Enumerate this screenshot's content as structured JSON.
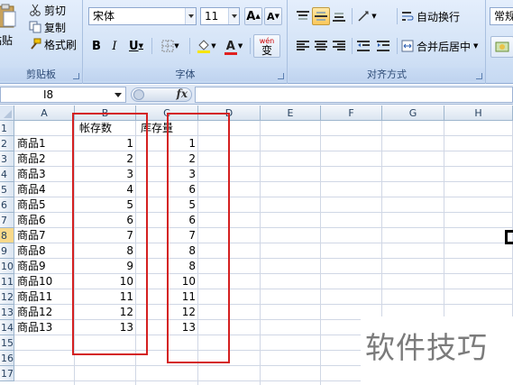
{
  "ribbon": {
    "clipboard": {
      "paste_label": "粘贴",
      "cut_label": "剪切",
      "copy_label": "复制",
      "format_painter_label": "格式刷",
      "group_label": "剪贴板"
    },
    "font": {
      "font_name": "宋体",
      "font_size": "11",
      "bold": "B",
      "italic": "I",
      "underline": "U",
      "grow_font": "A",
      "shrink_font": "A",
      "font_color_glyph": "A",
      "phonetic_glyph": "wén",
      "phonetic_char": "变",
      "group_label": "字体"
    },
    "alignment": {
      "wrap_text_label": "自动换行",
      "merge_center_label": "合并后居中",
      "group_label": "对齐方式"
    },
    "number": {
      "format_value": "常规"
    }
  },
  "formula_bar": {
    "name_box": "I8",
    "fx_label": "fx",
    "formula": ""
  },
  "grid": {
    "columns": [
      "A",
      "B",
      "C",
      "D",
      "E",
      "F",
      "G",
      "H"
    ],
    "row_numbers": [
      "1",
      "2",
      "3",
      "4",
      "5",
      "6",
      "7",
      "8",
      "9",
      "10",
      "11",
      "12",
      "13",
      "14",
      "15",
      "16",
      "17"
    ],
    "header_row": {
      "b": "帐存数",
      "c": "库存量"
    },
    "rows": [
      {
        "a": "商品1",
        "b": "1",
        "d": "1"
      },
      {
        "a": "商品2",
        "b": "2",
        "d": "2"
      },
      {
        "a": "商品3",
        "b": "3",
        "d": "3"
      },
      {
        "a": "商品4",
        "b": "4",
        "d": "6"
      },
      {
        "a": "商品5",
        "b": "5",
        "d": "5"
      },
      {
        "a": "商品6",
        "b": "6",
        "d": "6"
      },
      {
        "a": "商品7",
        "b": "7",
        "d": "7"
      },
      {
        "a": "商品8",
        "b": "8",
        "d": "8"
      },
      {
        "a": "商品9",
        "b": "9",
        "d": "8"
      },
      {
        "a": "商品10",
        "b": "10",
        "d": "10"
      },
      {
        "a": "商品11",
        "b": "11",
        "d": "11"
      },
      {
        "a": "商品12",
        "b": "12",
        "d": "12"
      },
      {
        "a": "商品13",
        "b": "13",
        "d": "13"
      }
    ],
    "selected_row": "8"
  },
  "watermark": "软件技巧",
  "colors": {
    "highlight_box": "#d42020",
    "ribbon_bg": "#d5e4f7",
    "font_color_bar": "#e02020",
    "fill_color_bar": "#f7e500"
  }
}
